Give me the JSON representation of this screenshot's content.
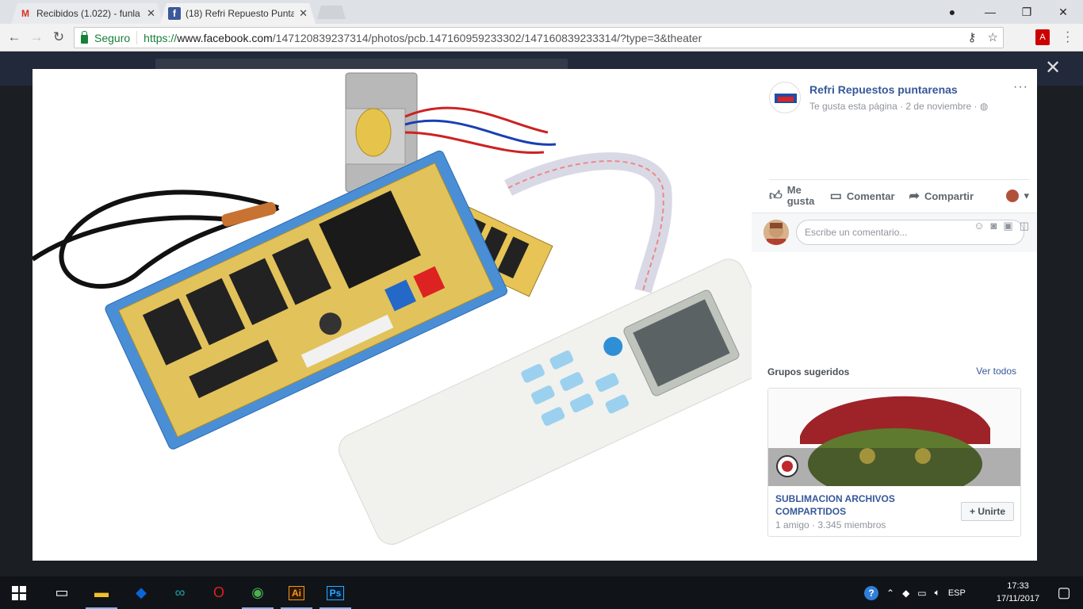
{
  "browser": {
    "tabs": [
      {
        "label": "Recibidos (1.022) - funla",
        "favicon": "gmail-icon"
      },
      {
        "label": "(18) Refri Repuesto Punta",
        "favicon": "facebook-icon"
      }
    ],
    "secure_label": "Seguro",
    "url_proto": "https://",
    "url_host": "www.facebook.com",
    "url_path": "/147120839237314/photos/pcb.147160959233302/147160839233314/?type=3&theater"
  },
  "post": {
    "page_name": "Refri Repuestos puntarenas",
    "meta": "Te gusta esta página · 2 de noviembre ·",
    "like_label": "Me gusta",
    "comment_label": "Comentar",
    "share_label": "Compartir",
    "comment_placeholder": "Escribe un comentario..."
  },
  "suggested_groups": {
    "title": "Grupos sugeridos",
    "see_all": "Ver todos",
    "group_name": "SUBLIMACION ARCHIVOS COMPARTIDOS",
    "group_meta": "1 amigo · 3.345 miembros",
    "join_label": "Unirte",
    "join_plus": "+"
  },
  "taskbar": {
    "lang": "ESP",
    "time": "17:33",
    "date": "17/11/2017",
    "apps": [
      "windows-start",
      "task-view",
      "file-explorer",
      "dropbox",
      "arduino",
      "opera",
      "chrome",
      "illustrator",
      "photoshop"
    ]
  },
  "icons": {
    "illustrator": "Ai",
    "photoshop": "Ps"
  },
  "colors": {
    "facebook_blue": "#3b5998",
    "link_blue": "#365899",
    "secure_green": "#188038"
  }
}
